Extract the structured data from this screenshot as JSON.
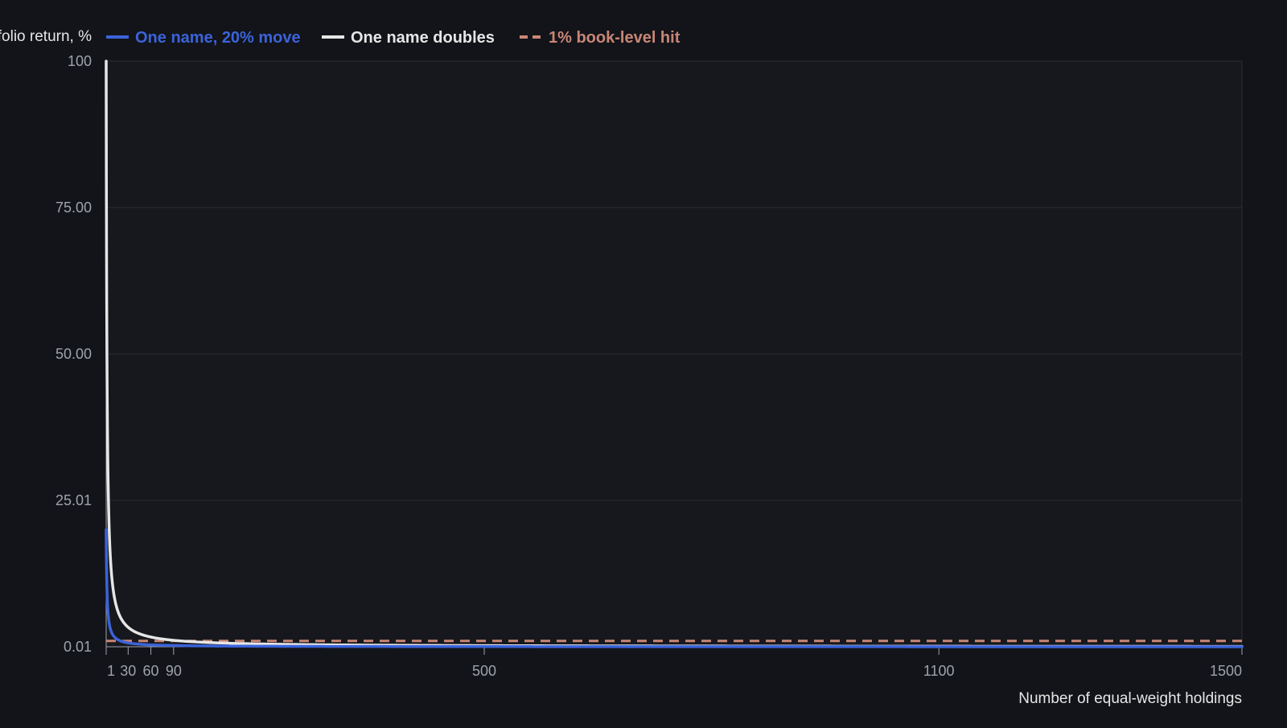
{
  "chart_data": {
    "type": "line",
    "title": "",
    "ylabel": "Portfolio return, %",
    "xlabel": "Number of equal-weight holdings",
    "xlim": [
      1,
      1500
    ],
    "ylim": [
      0.01,
      100
    ],
    "x_ticks": [
      {
        "value": 1,
        "label": "1"
      },
      {
        "value": 30,
        "label": "30"
      },
      {
        "value": 60,
        "label": "60"
      },
      {
        "value": 90,
        "label": "90"
      },
      {
        "value": 500,
        "label": "500"
      },
      {
        "value": 1100,
        "label": "1100"
      },
      {
        "value": 1500,
        "label": "1500"
      }
    ],
    "y_ticks": [
      {
        "value": 0.01,
        "label": "0.01"
      },
      {
        "value": 25.01,
        "label": "25.01"
      },
      {
        "value": 50.0,
        "label": "50.00"
      },
      {
        "value": 75.0,
        "label": "75.00"
      },
      {
        "value": 100,
        "label": "100"
      }
    ],
    "grid": true,
    "legend_position": "top",
    "series": [
      {
        "name": "One name, 20% move",
        "color": "#3b63d9",
        "style": "solid",
        "formula": "20/n",
        "points": [
          [
            1,
            20
          ],
          [
            2,
            10
          ],
          [
            3,
            6.67
          ],
          [
            5,
            4
          ],
          [
            10,
            2
          ],
          [
            20,
            1
          ],
          [
            30,
            0.67
          ],
          [
            60,
            0.33
          ],
          [
            90,
            0.22
          ],
          [
            200,
            0.1
          ],
          [
            500,
            0.04
          ],
          [
            1100,
            0.018
          ],
          [
            1500,
            0.013
          ]
        ]
      },
      {
        "name": "One name doubles",
        "color": "#e6e6e6",
        "style": "solid",
        "formula": "100/n",
        "points": [
          [
            1,
            100
          ],
          [
            2,
            50
          ],
          [
            3,
            33.3
          ],
          [
            5,
            20
          ],
          [
            10,
            10
          ],
          [
            20,
            5
          ],
          [
            30,
            3.33
          ],
          [
            60,
            1.67
          ],
          [
            90,
            1.11
          ],
          [
            200,
            0.5
          ],
          [
            500,
            0.2
          ],
          [
            1100,
            0.09
          ],
          [
            1500,
            0.067
          ]
        ]
      },
      {
        "name": "1% book-level hit",
        "color": "#c98676",
        "style": "dashed",
        "points": [
          [
            1,
            1
          ],
          [
            1500,
            1
          ]
        ]
      }
    ]
  },
  "colors": {
    "background": "#121419",
    "plot_background": "#16181d",
    "grid": "#2a2d33",
    "axis_text": "#9ea3ab",
    "label_text": "#e6e6e6"
  }
}
